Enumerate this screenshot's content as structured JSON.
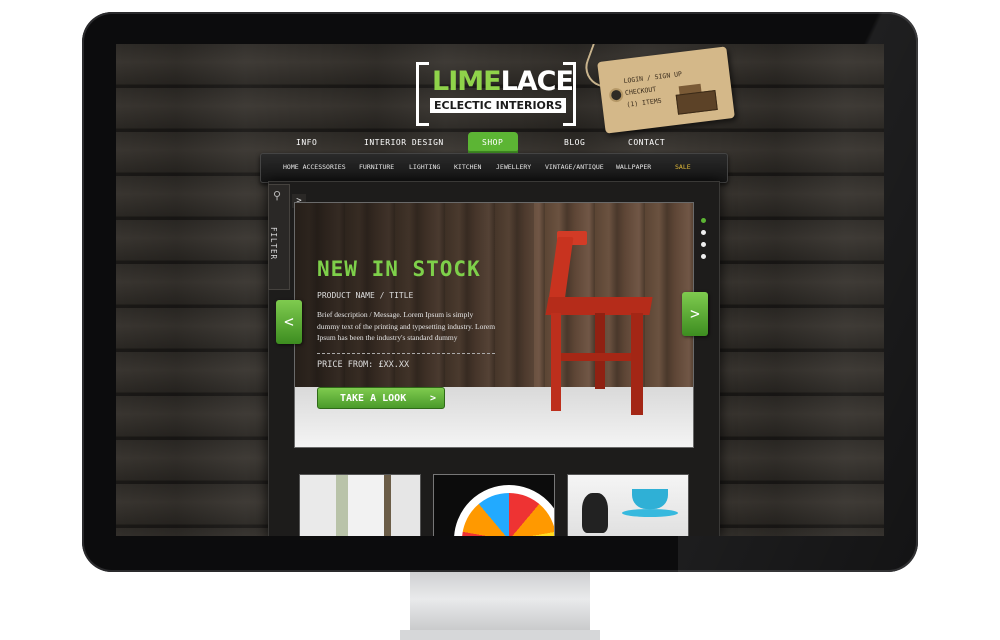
{
  "brand": {
    "name_part1": "LIME",
    "name_part2": "LACE",
    "tagline": "ECLECTIC INTERIORS",
    "colors": {
      "accent_green": "#5cb534",
      "headline_green": "#7ed04a",
      "sale_gold": "#e3bb3a",
      "wood_dark": "#2e2b27"
    }
  },
  "tag": {
    "login": "LOGIN / SIGN UP",
    "checkout": "CHECKOUT",
    "items": "(1) ITEMS",
    "icon": "cash-register-icon"
  },
  "main_nav": {
    "items": [
      "INFO",
      "INTERIOR DESIGN",
      "SHOP",
      "BLOG",
      "CONTACT"
    ],
    "active": "SHOP"
  },
  "sub_nav": {
    "items": [
      "HOME ACCESSORIES",
      "FURNITURE",
      "LIGHTING",
      "KITCHEN",
      "JEWELLERY",
      "VINTAGE/ANTIQUE",
      "WALLPAPER",
      "SALE"
    ]
  },
  "filter": {
    "label": "FILTER",
    "icons": [
      "search-icon",
      "chevron-right-icon"
    ]
  },
  "hero": {
    "title": "NEW IN STOCK",
    "product": "PRODUCT NAME / TITLE",
    "description": "Brief description / Message. Lorem Ipsum is simply dummy text of the printing and typesetting industry. Lorem Ipsum has been the industry's standard dummy",
    "price": "PRICE FROM: £XX.XX",
    "cta": "TAKE A LOOK",
    "prev_arrow": "<",
    "next_arrow": ">",
    "slides_total": 4,
    "slide_active": 1
  }
}
